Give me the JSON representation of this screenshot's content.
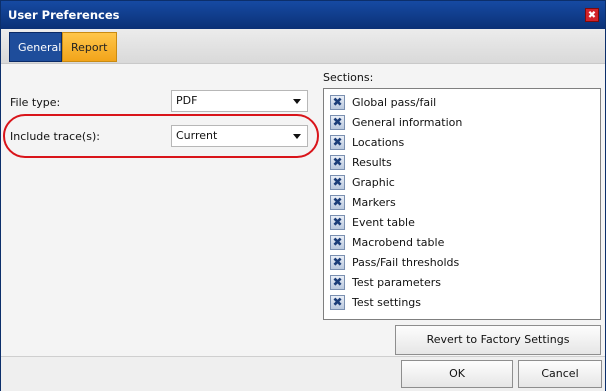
{
  "window": {
    "title": "User Preferences",
    "close_glyph": "✖"
  },
  "tabs": [
    {
      "label": "General",
      "active": false
    },
    {
      "label": "Report",
      "active": true
    }
  ],
  "form": {
    "file_type": {
      "label": "File type:",
      "value": "PDF"
    },
    "include_traces": {
      "label": "Include trace(s):",
      "value": "Current"
    }
  },
  "sections": {
    "label": "Sections:",
    "check_glyph": "✖",
    "items": [
      {
        "label": "Global pass/fail",
        "checked": true
      },
      {
        "label": "General information",
        "checked": true
      },
      {
        "label": "Locations",
        "checked": true
      },
      {
        "label": "Results",
        "checked": true
      },
      {
        "label": "Graphic",
        "checked": true
      },
      {
        "label": "Markers",
        "checked": true
      },
      {
        "label": "Event table",
        "checked": true
      },
      {
        "label": "Macrobend table",
        "checked": true
      },
      {
        "label": "Pass/Fail thresholds",
        "checked": true
      },
      {
        "label": "Test parameters",
        "checked": true
      },
      {
        "label": "Test settings",
        "checked": true
      }
    ]
  },
  "buttons": {
    "revert": "Revert to Factory Settings",
    "ok": "OK",
    "cancel": "Cancel"
  },
  "colors": {
    "titlebar": "#0d3a8a",
    "tab_general": "#1e4d9b",
    "tab_report": "#f2a41a",
    "highlight": "#d9141a"
  }
}
